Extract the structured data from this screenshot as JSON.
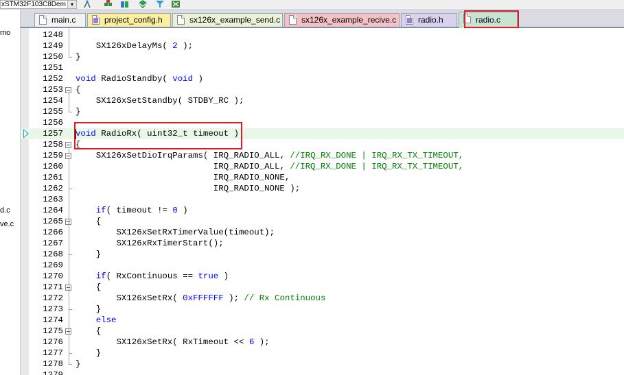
{
  "toolbar": {
    "target_name": "xSTM32F103C8Dem",
    "dropdown_glyph": "▾",
    "icons": [
      "options-for-target-icon",
      "manage-components-icon",
      "manage-books-icon",
      "pack-installer-icon",
      "select-packs-icon",
      "debug-settings-icon"
    ]
  },
  "left_pane": {
    "fragments": [
      "mo",
      "d.c",
      "ve.c"
    ]
  },
  "tabs": [
    {
      "label": "main.c",
      "color": "#f3f3f3",
      "kind": "c"
    },
    {
      "label": "project_config.h",
      "color": "#fbef9e",
      "kind": "h"
    },
    {
      "label": "sx126x_example_send.c",
      "color": "#ecf2d8",
      "kind": "c"
    },
    {
      "label": "sx126x_example_recive.c",
      "color": "#f4c2c6",
      "kind": "c"
    },
    {
      "label": "radio.h",
      "color": "#d9d2ee",
      "kind": "h"
    },
    {
      "label": "radio.c",
      "color": "#c6e3d3",
      "kind": "c",
      "active": true
    }
  ],
  "editor": {
    "current_line": "1257",
    "lines": [
      {
        "n": "1248",
        "text": ""
      },
      {
        "n": "1249",
        "text": "    SX126xDelayMs( 2 );"
      },
      {
        "n": "1250",
        "text": "}"
      },
      {
        "n": "1251",
        "text": ""
      },
      {
        "n": "1252",
        "text": "void RadioStandby( void )"
      },
      {
        "n": "1253",
        "text": "{"
      },
      {
        "n": "1254",
        "text": "    SX126xSetStandby( STDBY_RC );"
      },
      {
        "n": "1255",
        "text": "}"
      },
      {
        "n": "1256",
        "text": ""
      },
      {
        "n": "1257",
        "text": "void RadioRx( uint32_t timeout )"
      },
      {
        "n": "1258",
        "text": "{"
      },
      {
        "n": "1259",
        "text": "    SX126xSetDioIrqParams( IRQ_RADIO_ALL, //IRQ_RX_DONE | IRQ_RX_TX_TIMEOUT,"
      },
      {
        "n": "1260",
        "text": "                           IRQ_RADIO_ALL, //IRQ_RX_DONE | IRQ_RX_TX_TIMEOUT,"
      },
      {
        "n": "1261",
        "text": "                           IRQ_RADIO_NONE,"
      },
      {
        "n": "1262",
        "text": "                           IRQ_RADIO_NONE );"
      },
      {
        "n": "1263",
        "text": ""
      },
      {
        "n": "1264",
        "text": "    if( timeout != 0 )"
      },
      {
        "n": "1265",
        "text": "    {"
      },
      {
        "n": "1266",
        "text": "        SX126xSetRxTimerValue(timeout);"
      },
      {
        "n": "1267",
        "text": "        SX126xRxTimerStart();"
      },
      {
        "n": "1268",
        "text": "    }"
      },
      {
        "n": "1269",
        "text": ""
      },
      {
        "n": "1270",
        "text": "    if( RxContinuous == true )"
      },
      {
        "n": "1271",
        "text": "    {"
      },
      {
        "n": "1272",
        "text": "        SX126xSetRx( 0xFFFFFF ); // Rx Continuous"
      },
      {
        "n": "1273",
        "text": "    }"
      },
      {
        "n": "1274",
        "text": "    else"
      },
      {
        "n": "1275",
        "text": "    {"
      },
      {
        "n": "1276",
        "text": "        SX126xSetRx( RxTimeout << 6 );"
      },
      {
        "n": "1277",
        "text": "    }"
      },
      {
        "n": "1278",
        "text": "}"
      },
      {
        "n": "1279",
        "text": ""
      }
    ]
  },
  "colors": {
    "keyword": "#0000ff",
    "comment": "#008000",
    "number": "#0000ff",
    "current_line_bg": "#e8f7e8",
    "annotation_red": "#e01c24"
  }
}
